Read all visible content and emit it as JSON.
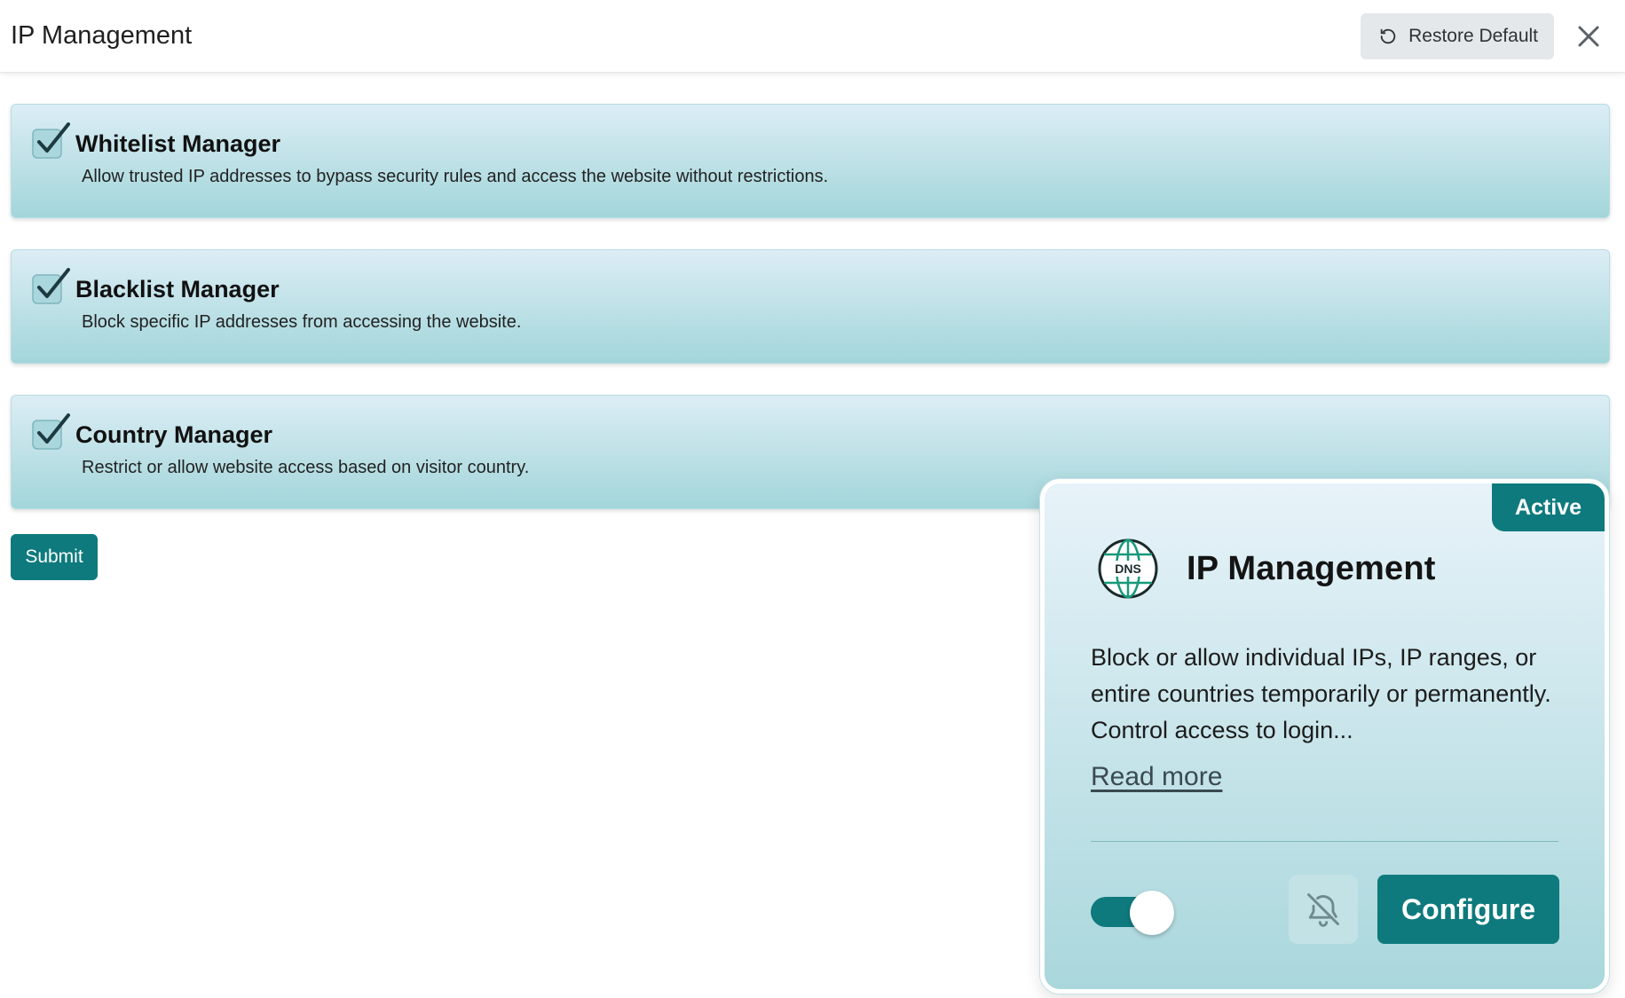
{
  "header": {
    "title": "IP Management",
    "restore_label": "Restore Default"
  },
  "features": [
    {
      "title": "Whitelist Manager",
      "description": "Allow trusted IP addresses to bypass security rules and access the website without restrictions.",
      "checked": true
    },
    {
      "title": "Blacklist Manager",
      "description": "Block specific IP addresses from accessing the website.",
      "checked": true
    },
    {
      "title": "Country Manager",
      "description": "Restrict or allow website access based on visitor country.",
      "checked": true
    }
  ],
  "submit_label": "Submit",
  "module": {
    "badge": "Active",
    "icon_text": "DNS",
    "title": "IP Management",
    "description": "Block or allow individual IPs, IP ranges, or entire countries temporarily or permanently. Control access to login...",
    "read_more": "Read more",
    "enabled": true,
    "configure_label": "Configure"
  },
  "colors": {
    "accent": "#0e7a7d",
    "card_top": "#dcedf5",
    "card_bottom": "#a2d6da"
  },
  "icons": {
    "restore": "restore-icon",
    "close": "close-icon",
    "check": "checkbox-checked-icon",
    "module": "dns-globe-icon",
    "mute": "bell-off-icon"
  }
}
